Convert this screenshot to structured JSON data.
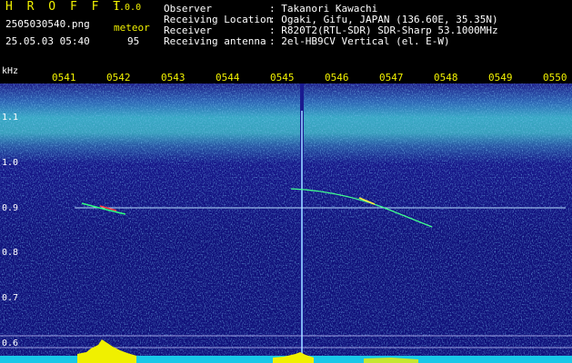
{
  "app": {
    "name": "H R O F F T",
    "version": "1.0.0"
  },
  "file": {
    "name": "2505030540.png",
    "datetime": "25.05.03 05:40"
  },
  "meteor": {
    "label": "meteor",
    "count": "95"
  },
  "info": [
    {
      "key": "Observer",
      "value": ": Takanori Kawachi"
    },
    {
      "key": "Receiving Location",
      "value": ": Ogaki, Gifu, JAPAN (136.60E, 35.35N)"
    },
    {
      "key": "Receiver",
      "value": ": R820T2(RTL-SDR) SDR-Sharp 53.1000MHz"
    },
    {
      "key": "Receiving antenna",
      "value": ": 2el-HB9CV Vertical (el. E-W)"
    }
  ],
  "axis": {
    "unit": "kHz",
    "time_ticks": [
      "0541",
      "0542",
      "0543",
      "0544",
      "0545",
      "0546",
      "0547",
      "0548",
      "0549",
      "0550"
    ],
    "freq_ticks": [
      "1.1",
      "1.0",
      "0.9",
      "0.8",
      "0.7",
      "0.6"
    ]
  },
  "colors": {
    "bg": "#000000",
    "spectrum_bg": "#10107a",
    "band": "#2aa8c8",
    "signal": "#00ff40",
    "carrier": "#b8e0ff",
    "label": "#f0f000"
  }
}
